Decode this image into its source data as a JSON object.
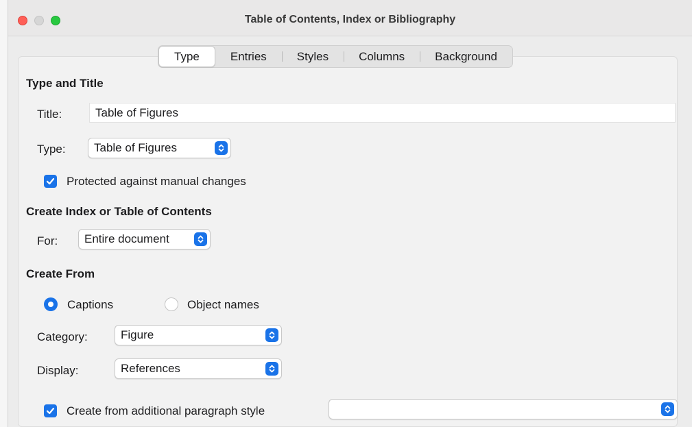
{
  "window": {
    "title": "Table of Contents, Index or Bibliography"
  },
  "tabs": [
    {
      "label": "Type",
      "active": true
    },
    {
      "label": "Entries",
      "active": false
    },
    {
      "label": "Styles",
      "active": false
    },
    {
      "label": "Columns",
      "active": false
    },
    {
      "label": "Background",
      "active": false
    }
  ],
  "type_and_title": {
    "heading": "Type and Title",
    "title_label": "Title:",
    "title_value": "Table of Figures",
    "type_label": "Type:",
    "type_value": "Table of Figures",
    "protected_label": "Protected against manual changes",
    "protected_checked": true
  },
  "create_index": {
    "heading": "Create Index or Table of Contents",
    "for_label": "For:",
    "for_value": "Entire document"
  },
  "create_from": {
    "heading": "Create From",
    "captions_label": "Captions",
    "captions_selected": true,
    "object_names_label": "Object names",
    "object_names_selected": false,
    "category_label": "Category:",
    "category_value": "Figure",
    "display_label": "Display:",
    "display_value": "References",
    "additional_style_label": "Create from additional paragraph style",
    "additional_style_checked": true,
    "additional_style_value": ""
  },
  "colors": {
    "accent": "#1a73e8",
    "close": "#fe5f57",
    "maximize": "#28c840"
  }
}
